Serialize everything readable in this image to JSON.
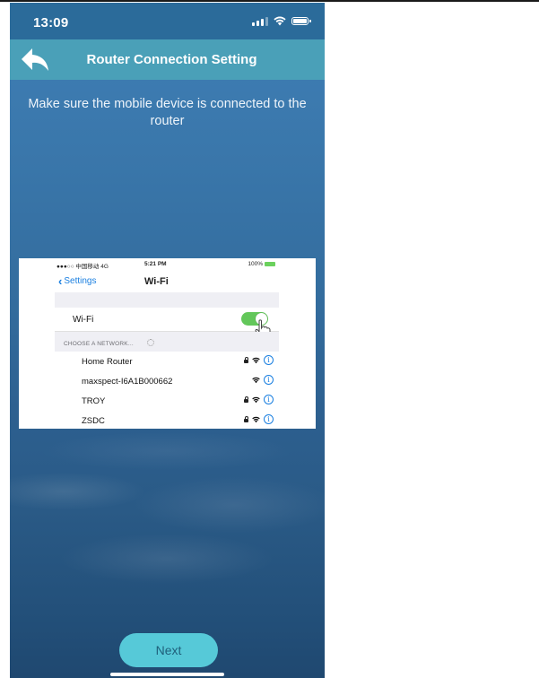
{
  "status_bar": {
    "time": "13:09"
  },
  "nav": {
    "title": "Router Connection Setting",
    "back_icon": "back-arrow-icon"
  },
  "instruction": "Make sure the mobile device is connected to the router",
  "preview": {
    "status": {
      "carrier": "●●●○○ 中国移动  4G",
      "time": "5:21 PM",
      "battery": "100%"
    },
    "back_label": "Settings",
    "title": "Wi-Fi",
    "wifi_label": "Wi-Fi",
    "wifi_enabled": true,
    "section_header": "CHOOSE A NETWORK...",
    "networks": [
      {
        "name": "Home Router",
        "locked": true
      },
      {
        "name": "maxspect-I6A1B000662",
        "locked": false
      },
      {
        "name": "TROY",
        "locked": true
      },
      {
        "name": "ZSDC",
        "locked": true
      }
    ]
  },
  "next_label": "Next",
  "colors": {
    "nav_bar": "#4aa0b8",
    "next_button": "#56c9d8",
    "toggle_on": "#63c75a",
    "ios_blue": "#1a7fe0"
  }
}
